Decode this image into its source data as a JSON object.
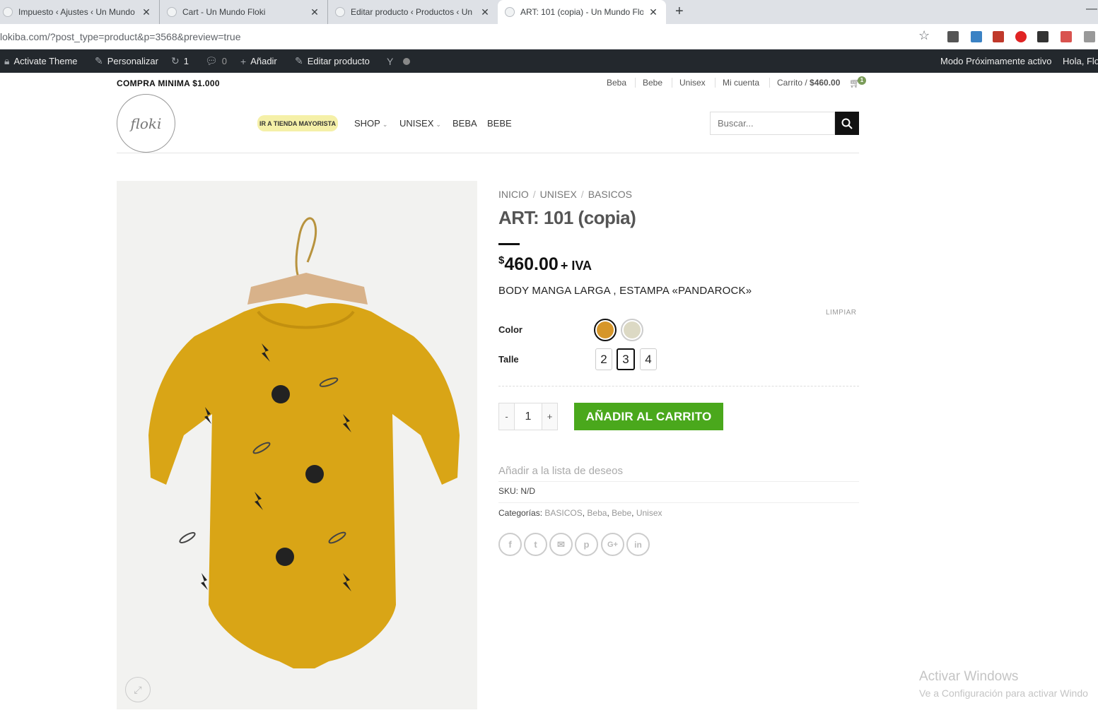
{
  "browser": {
    "tabs": [
      {
        "title": "Impuesto ‹ Ajustes ‹ Un Mundo F",
        "close": "✕"
      },
      {
        "title": "Cart - Un Mundo Floki",
        "close": "✕"
      },
      {
        "title": "Editar producto ‹ Productos ‹ Un",
        "close": "✕"
      },
      {
        "title": "ART: 101 (copia) - Un Mundo Flo",
        "close": "✕"
      }
    ],
    "new_tab": "+",
    "url": "lokiba.com/?post_type=product&p=3568&preview=true"
  },
  "admin_bar": {
    "activate_theme": "Activate Theme",
    "personalizar": "Personalizar",
    "updates_count": "1",
    "comments_count": "0",
    "add_new": "Añadir",
    "edit_product": "Editar producto",
    "coming_soon": "Modo Próximamente activo",
    "greeting": "Hola, Flo"
  },
  "header": {
    "top_left": "COMPRA MINIMA $1.000",
    "top_links": [
      "Beba",
      "Bebe",
      "Unisex",
      "Mi cuenta"
    ],
    "cart_label": "Carrito /",
    "cart_amount": "$460.00",
    "cart_count": "1",
    "logo_text": "floki",
    "mayorista_badge": "IR A TIENDA MAYORISTA",
    "nav": [
      "SHOP",
      "UNISEX",
      "BEBA",
      "BEBE"
    ],
    "search_placeholder": "Buscar..."
  },
  "product": {
    "breadcrumb": [
      "INICIO",
      "UNISEX",
      "BASICOS"
    ],
    "title": "ART: 101 (copia)",
    "price_symbol": "$",
    "price_value": "460.00",
    "price_suffix": "+ IVA",
    "description": "BODY MANGA LARGA , ESTAMPA «PANDAROCK»",
    "clear_label": "LIMPIAR",
    "color_label": "Color",
    "color_options": [
      "#d6962a",
      "#dcd9c4"
    ],
    "size_label": "Talle",
    "sizes": [
      "2",
      "3",
      "4"
    ],
    "selected_size": "3",
    "qty_minus": "-",
    "qty_value": "1",
    "qty_plus": "+",
    "add_to_cart": "AÑADIR AL CARRITO",
    "wishlist": "Añadir a la lista de deseos",
    "sku_label": "SKU:",
    "sku_value": "N/D",
    "categories_label": "Categorías:",
    "categories": [
      "BASICOS",
      "Beba",
      "Bebe",
      "Unisex"
    ],
    "share_icons": [
      "f",
      "t",
      "✉",
      "p",
      "G+",
      "in"
    ]
  },
  "windows_watermark": {
    "line1": "Activar Windows",
    "line2": "Ve a Configuración para activar Windo"
  },
  "colors": {
    "add_to_cart_bg": "#4aa81c",
    "admin_bar_bg": "#23282d",
    "garment": "#d9a516"
  }
}
